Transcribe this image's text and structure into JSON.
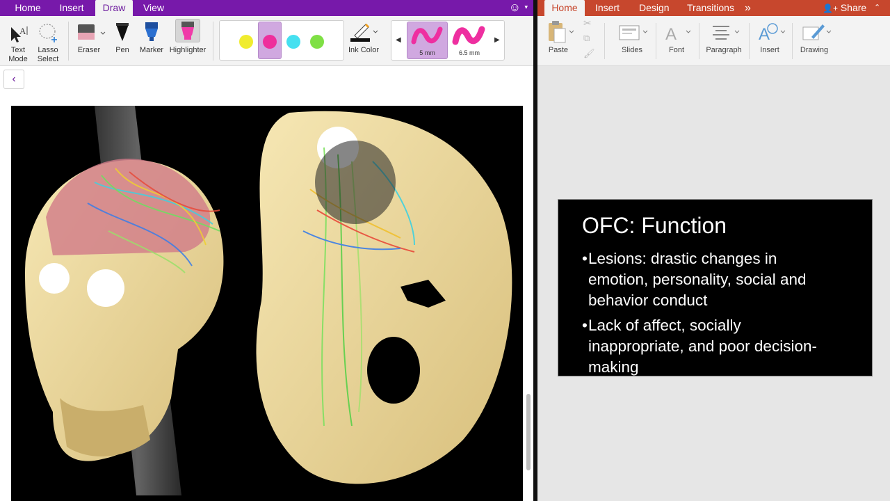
{
  "onenote": {
    "tabs": [
      "Home",
      "Insert",
      "Draw",
      "View"
    ],
    "active_tab": "Draw",
    "ribbon": {
      "text_mode": [
        "Text",
        "Mode"
      ],
      "lasso_select": [
        "Lasso",
        "Select"
      ],
      "eraser": "Eraser",
      "pen": "Pen",
      "marker": "Marker",
      "highlighter": "Highlighter",
      "ink_color": "Ink Color",
      "pen_colors": [
        "#f0ec2e",
        "#ee2f9c",
        "#45e0f0",
        "#7fe045"
      ],
      "selected_color_index": 1,
      "sizes": [
        "5 mm",
        "6.5 mm"
      ],
      "selected_size_index": 0
    },
    "accent": "#7719aa"
  },
  "ppt": {
    "tabs": [
      "Home",
      "Insert",
      "Design",
      "Transitions"
    ],
    "active_tab": "Home",
    "more": "»",
    "share": "Share",
    "ribbon": [
      "Paste",
      "Slides",
      "Font",
      "Paragraph",
      "Insert",
      "Drawing"
    ],
    "accent": "#c7472d",
    "slide": {
      "title": "OFC: Function",
      "bullets": [
        {
          "lines": [
            "Lesions: drastic changes in",
            "emotion, personality, social and",
            "behavior conduct"
          ]
        },
        {
          "lines": [
            "Lack of affect, socially",
            "inappropriate, and poor decision-",
            "making"
          ]
        }
      ]
    }
  }
}
